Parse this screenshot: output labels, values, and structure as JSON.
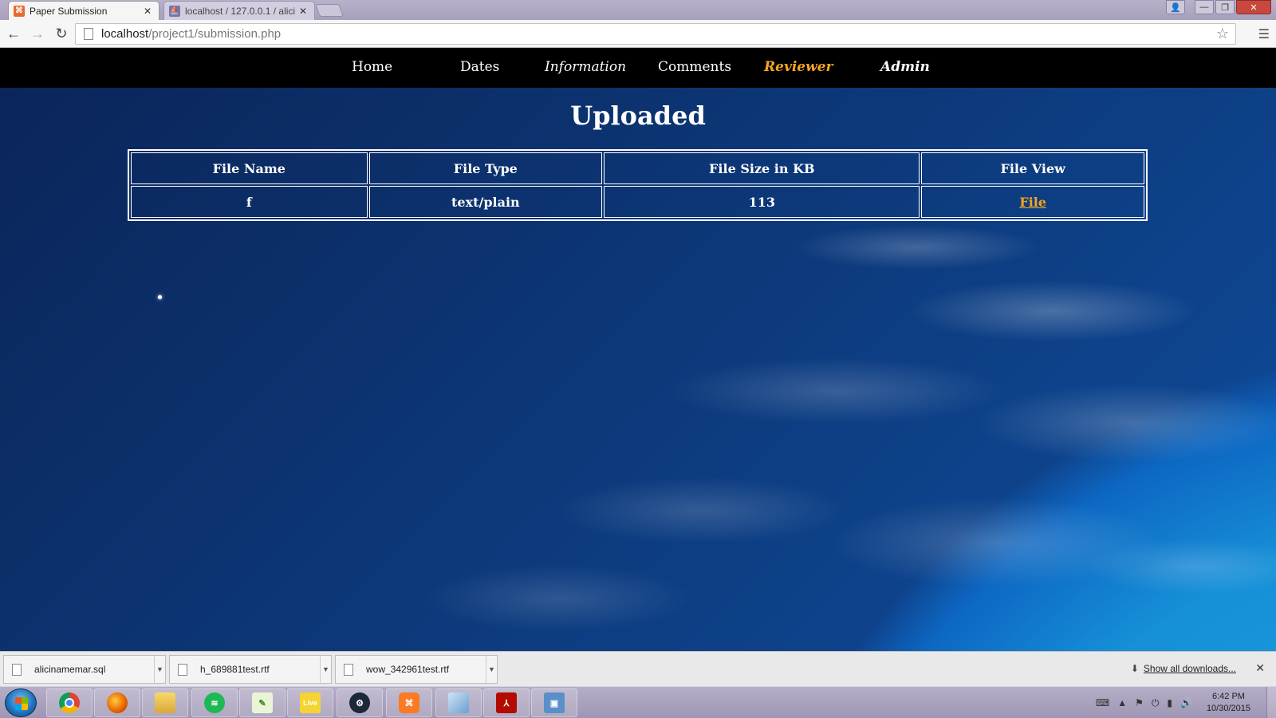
{
  "browser": {
    "tabs": [
      {
        "title": "Paper Submission",
        "favicon": "xampp-icon",
        "favicon_color": "#e8692e"
      },
      {
        "title": "localhost / 127.0.0.1 / alici",
        "favicon": "phpmyadmin-icon",
        "favicon_color": "#6c78af"
      }
    ],
    "url_host": "localhost",
    "url_path": "/project1/submission.php"
  },
  "site_nav": {
    "home": "Home",
    "dates": "Dates",
    "information": "Information",
    "comments": "Comments",
    "reviewer": "Reviewer",
    "admin": "Admin",
    "accent_color": "#f5a623"
  },
  "page": {
    "title": "Uploaded"
  },
  "table": {
    "headers": [
      "File Name",
      "File Type",
      "File Size in KB",
      "File View"
    ],
    "rows": [
      {
        "name": "f",
        "type": "text/plain",
        "size_kb": "113",
        "view_link": "File"
      }
    ]
  },
  "downloads": {
    "items": [
      "alicinamemar.sql",
      "h_689881test.rtf",
      "wow_342961test.rtf"
    ],
    "show_all": "Show all downloads..."
  },
  "taskbar": {
    "apps": [
      "chrome",
      "firefox",
      "file-explorer",
      "spotify",
      "notepad-plus-plus",
      "windows-live",
      "steam",
      "xampp",
      "virtualbox",
      "adobe-acrobat",
      "remote-desktop"
    ],
    "time": "6:42 PM",
    "date": "10/30/2015"
  }
}
